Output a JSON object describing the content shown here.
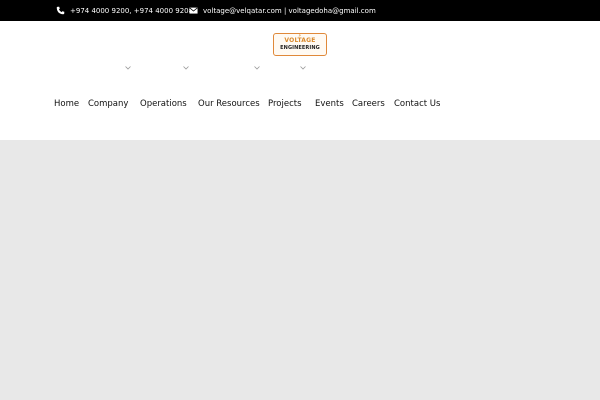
{
  "topbar": {
    "phone": "+974 4000 9200, +974 4000 9208",
    "email": "voltage@velqatar.com | voltagedoha@gmail.com",
    "phone_icon": "phone-icon",
    "email_icon": "envelope-icon"
  },
  "logo": {
    "line1": "VOLTAGE",
    "line2": "ENGINEERING"
  },
  "nav": {
    "items": [
      {
        "label": "Home"
      },
      {
        "label": "Company"
      },
      {
        "label": "Operations"
      },
      {
        "label": "Our Resources"
      },
      {
        "label": "Projects"
      },
      {
        "label": "Events"
      },
      {
        "label": "Careers"
      },
      {
        "label": "Contact Us"
      }
    ]
  },
  "colors": {
    "topbar_bg": "#000000",
    "logo_accent": "#e0893a",
    "body_gray": "#e8e8e8"
  }
}
